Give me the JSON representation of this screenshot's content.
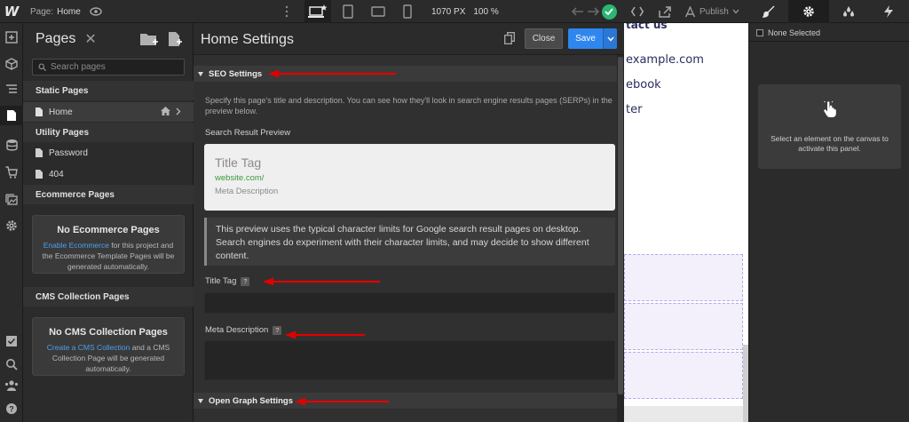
{
  "topbar": {
    "page_prefix": "Page:",
    "page_name": "Home",
    "width_value": "1070 PX",
    "zoom": "100 %",
    "publish_label": "Publish",
    "status": "published-ok"
  },
  "rail": {
    "icons": [
      "add-icon",
      "cube-icon",
      "navigator-icon",
      "pages-icon",
      "cms-icon",
      "cart-icon",
      "assets-icon",
      "settings-icon",
      "audit-icon",
      "search-icon",
      "users-icon",
      "help-icon"
    ]
  },
  "pages": {
    "title": "Pages",
    "close_glyph": "✕",
    "search_placeholder": "Search pages",
    "static_heading": "Static Pages",
    "home_label": "Home",
    "utility_heading": "Utility Pages",
    "password_label": "Password",
    "not_found_label": "404",
    "ecommerce_heading": "Ecommerce Pages",
    "ecom_box_title": "No Ecommerce Pages",
    "ecom_box_link": "Enable Ecommerce",
    "ecom_box_text": " for this project and the Ecommerce Template Pages will be generated automatically.",
    "cms_heading": "CMS Collection Pages",
    "cms_box_title": "No CMS Collection Pages",
    "cms_box_link": "Create a CMS Collection",
    "cms_box_text": " and a CMS Collection Page will be generated automatically."
  },
  "settings": {
    "title": "Home Settings",
    "close_label": "Close",
    "save_label": "Save",
    "seo_heading": "SEO Settings",
    "seo_description": "Specify this page's title and description. You can see how they'll look in search engine results pages (SERPs) in the preview below.",
    "serp_label": "Search Result Preview",
    "serp_title": "Title Tag",
    "serp_url": "website.com/",
    "serp_meta": "Meta Description",
    "note": "This preview uses the typical character limits for Google search result pages on desktop. Search engines do experiment with their character limits, and may decide to show different content.",
    "title_tag_label": "Title Tag",
    "title_tag_value": "",
    "meta_label": "Meta Description",
    "meta_value": "",
    "help_glyph": "?",
    "og_heading": "Open Graph Settings"
  },
  "canvas": {
    "heading": "tact us",
    "email": "example.com",
    "facebook": "ebook",
    "twitter": "ter"
  },
  "right_panel": {
    "none_selected": "None Selected",
    "hint": "Select an element on the canvas to activate this panel."
  },
  "colors": {
    "accent_blue": "#2f86ee",
    "success_green": "#2bb673",
    "annotation_red": "#e00000",
    "link_blue": "#4aa0ee"
  }
}
